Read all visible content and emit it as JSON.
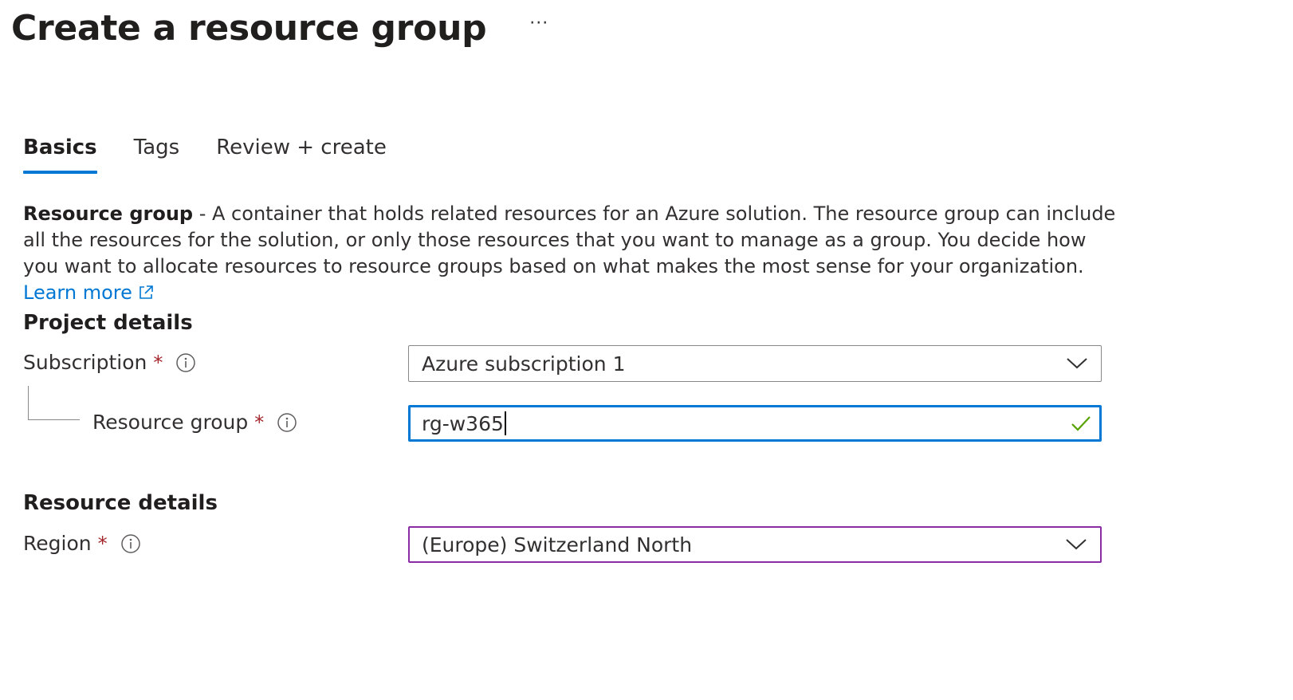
{
  "header": {
    "title": "Create a resource group",
    "more_label": "···"
  },
  "tabs": [
    {
      "label": "Basics",
      "active": true
    },
    {
      "label": "Tags",
      "active": false
    },
    {
      "label": "Review + create",
      "active": false
    }
  ],
  "description": {
    "term": "Resource group",
    "text": " - A container that holds related resources for an Azure solution. The resource group can include all the resources for the solution, or only those resources that you want to manage as a group. You decide how you want to allocate resources to resource groups based on what makes the most sense for your organization. ",
    "learn_more": "Learn more"
  },
  "project_details": {
    "heading": "Project details",
    "subscription": {
      "label": "Subscription",
      "required_mark": "*",
      "value": "Azure subscription 1"
    },
    "resource_group": {
      "label": "Resource group",
      "required_mark": "*",
      "value": "rg-w365"
    }
  },
  "resource_details": {
    "heading": "Resource details",
    "region": {
      "label": "Region",
      "required_mark": "*",
      "value": "(Europe) Switzerland North"
    }
  },
  "colors": {
    "accent": "#0078d4",
    "required": "#a4262c",
    "valid": "#57a300",
    "region_border": "#8a2da5"
  }
}
